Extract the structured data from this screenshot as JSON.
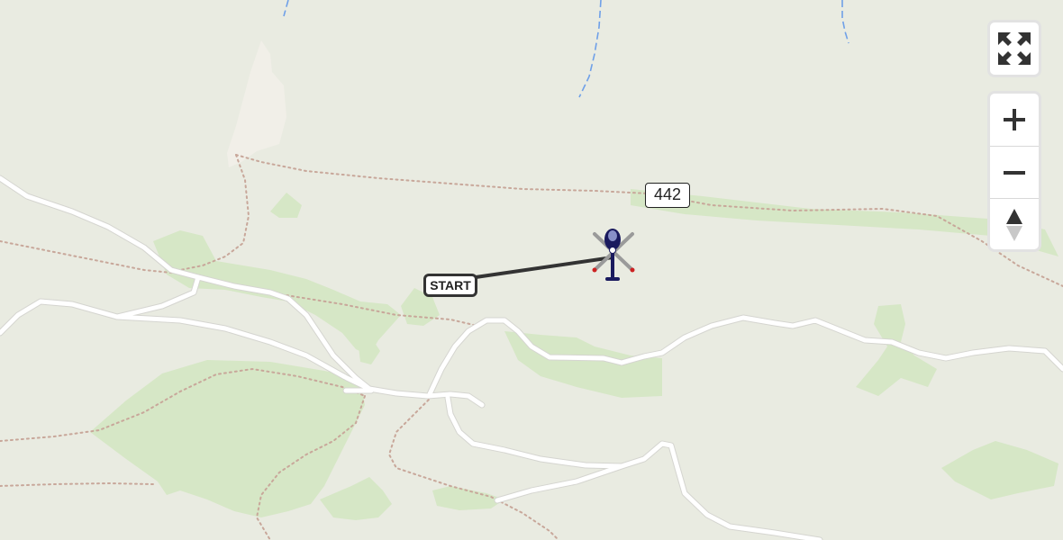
{
  "map": {
    "road_number": "442",
    "route_start_label": "START",
    "vehicle_icon": "helicopter-icon",
    "colors": {
      "land": "#e9ebe1",
      "forest": "#d6e7c6",
      "road": "#ffffff",
      "path": "#c8a79a",
      "water": "#6fa0e8",
      "route": "#333333",
      "helicopter": "#1a1a5e"
    }
  },
  "controls": {
    "fullscreen_icon": "expand-arrows-icon",
    "zoom_in_icon": "plus-icon",
    "zoom_out_icon": "minus-icon",
    "compass_icon": "compass-north-icon"
  }
}
